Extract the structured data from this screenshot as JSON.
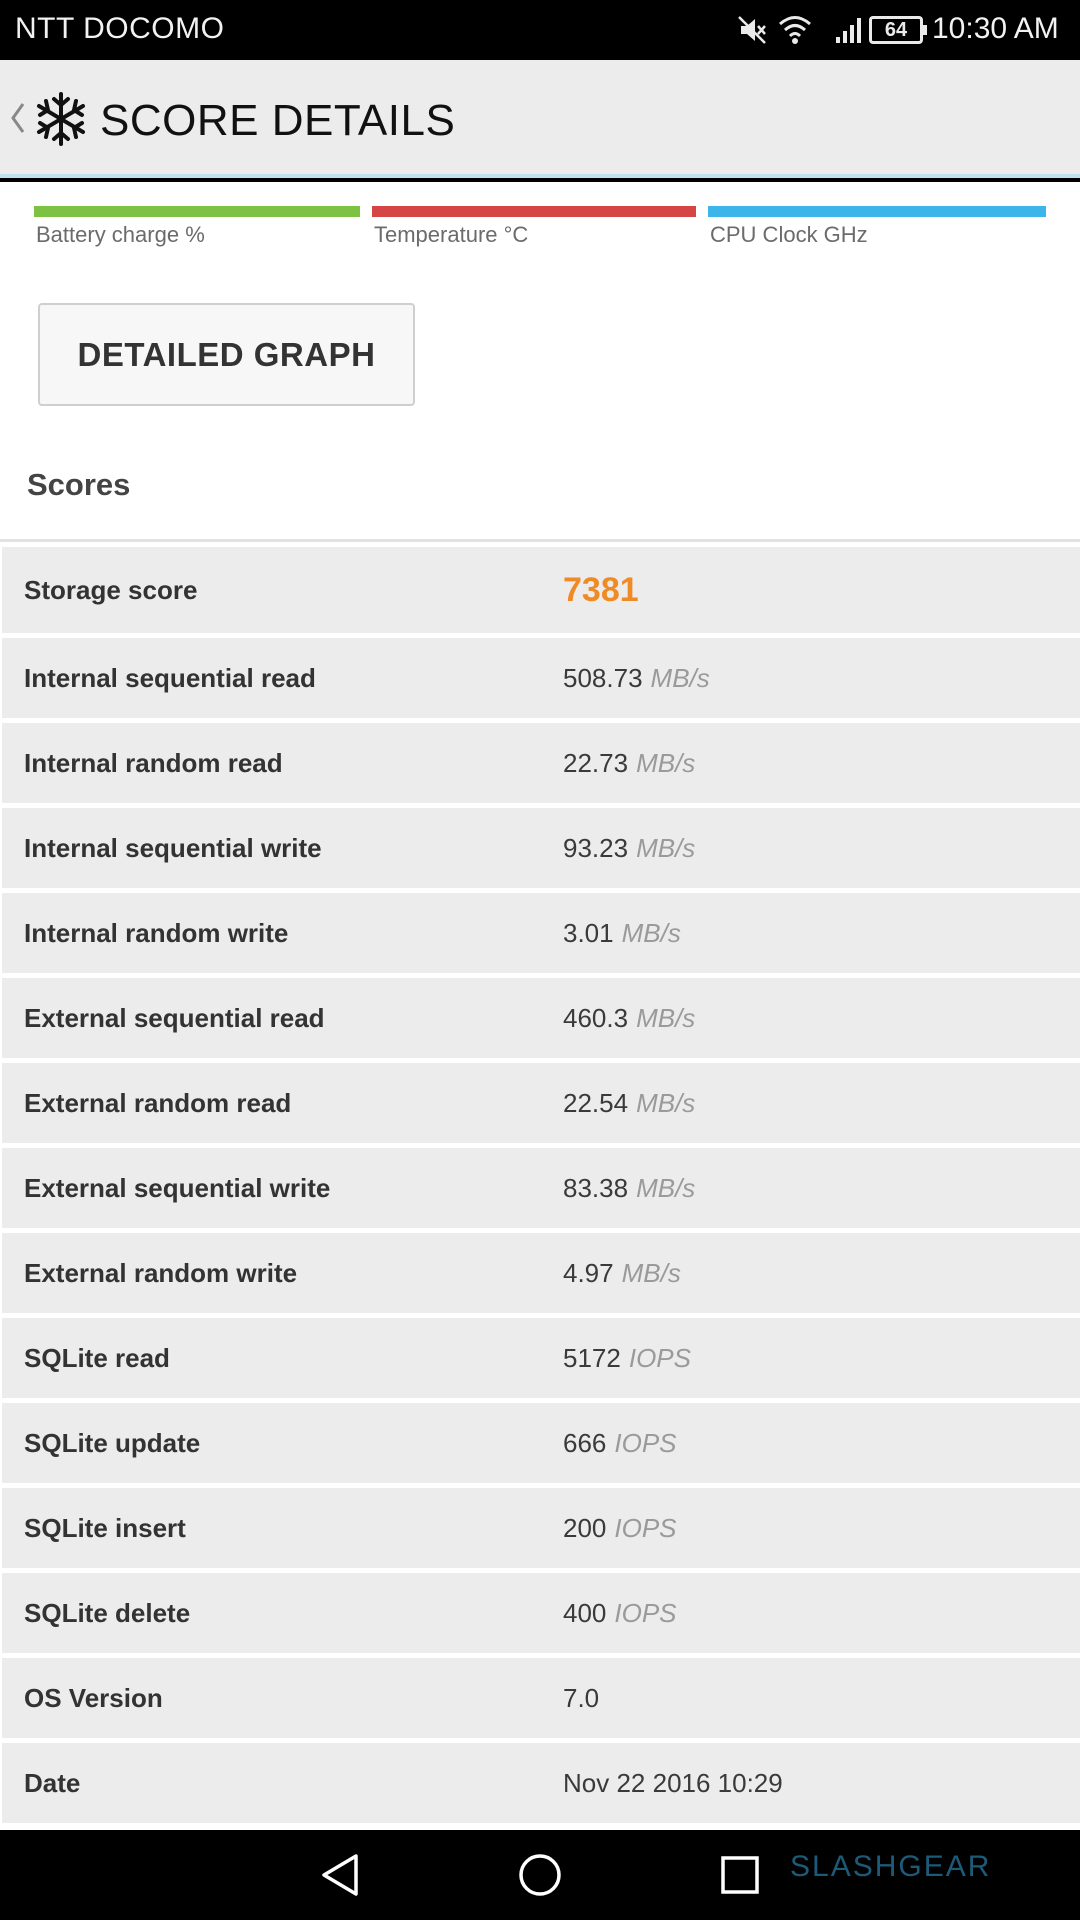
{
  "status_bar": {
    "carrier": "NTT DOCOMO",
    "battery": "64",
    "time": "10:30 AM",
    "icons": [
      "mute-icon",
      "wifi-icon",
      "signal-icon",
      "battery-icon"
    ]
  },
  "app_bar": {
    "title": "SCORE DETAILS",
    "icons": [
      "back-chevron-icon",
      "snowflake-icon"
    ]
  },
  "legend": [
    {
      "label": "Battery charge %",
      "color": "#7dc242"
    },
    {
      "label": "Temperature °C",
      "color": "#d64545"
    },
    {
      "label": "CPU Clock GHz",
      "color": "#3cb6ea"
    }
  ],
  "graph_button": {
    "label": "DETAILED GRAPH"
  },
  "scores": {
    "title": "Scores",
    "score_color": "#f08a24",
    "rows": [
      {
        "name": "Storage score",
        "value": "7381",
        "unit": ""
      },
      {
        "name": "Internal sequential read",
        "value": "508.73",
        "unit": "MB/s"
      },
      {
        "name": "Internal random read",
        "value": "22.73",
        "unit": "MB/s"
      },
      {
        "name": "Internal sequential write",
        "value": "93.23",
        "unit": "MB/s"
      },
      {
        "name": "Internal random write",
        "value": "3.01",
        "unit": "MB/s"
      },
      {
        "name": "External sequential read",
        "value": "460.3",
        "unit": "MB/s"
      },
      {
        "name": "External random read",
        "value": "22.54",
        "unit": "MB/s"
      },
      {
        "name": "External sequential write",
        "value": "83.38",
        "unit": "MB/s"
      },
      {
        "name": "External random write",
        "value": "4.97",
        "unit": "MB/s"
      },
      {
        "name": "SQLite read",
        "value": "5172",
        "unit": "IOPS"
      },
      {
        "name": "SQLite update",
        "value": "666",
        "unit": "IOPS"
      },
      {
        "name": "SQLite insert",
        "value": "200",
        "unit": "IOPS"
      },
      {
        "name": "SQLite delete",
        "value": "400",
        "unit": "IOPS"
      },
      {
        "name": "OS Version",
        "value": "7.0",
        "unit": ""
      },
      {
        "name": "Date",
        "value": "Nov 22 2016 10:29",
        "unit": ""
      }
    ]
  },
  "nav_bar": {
    "icons": [
      "back-triangle-icon",
      "home-circle-icon",
      "recents-square-icon"
    ]
  },
  "watermark": "SLASHGEAR"
}
